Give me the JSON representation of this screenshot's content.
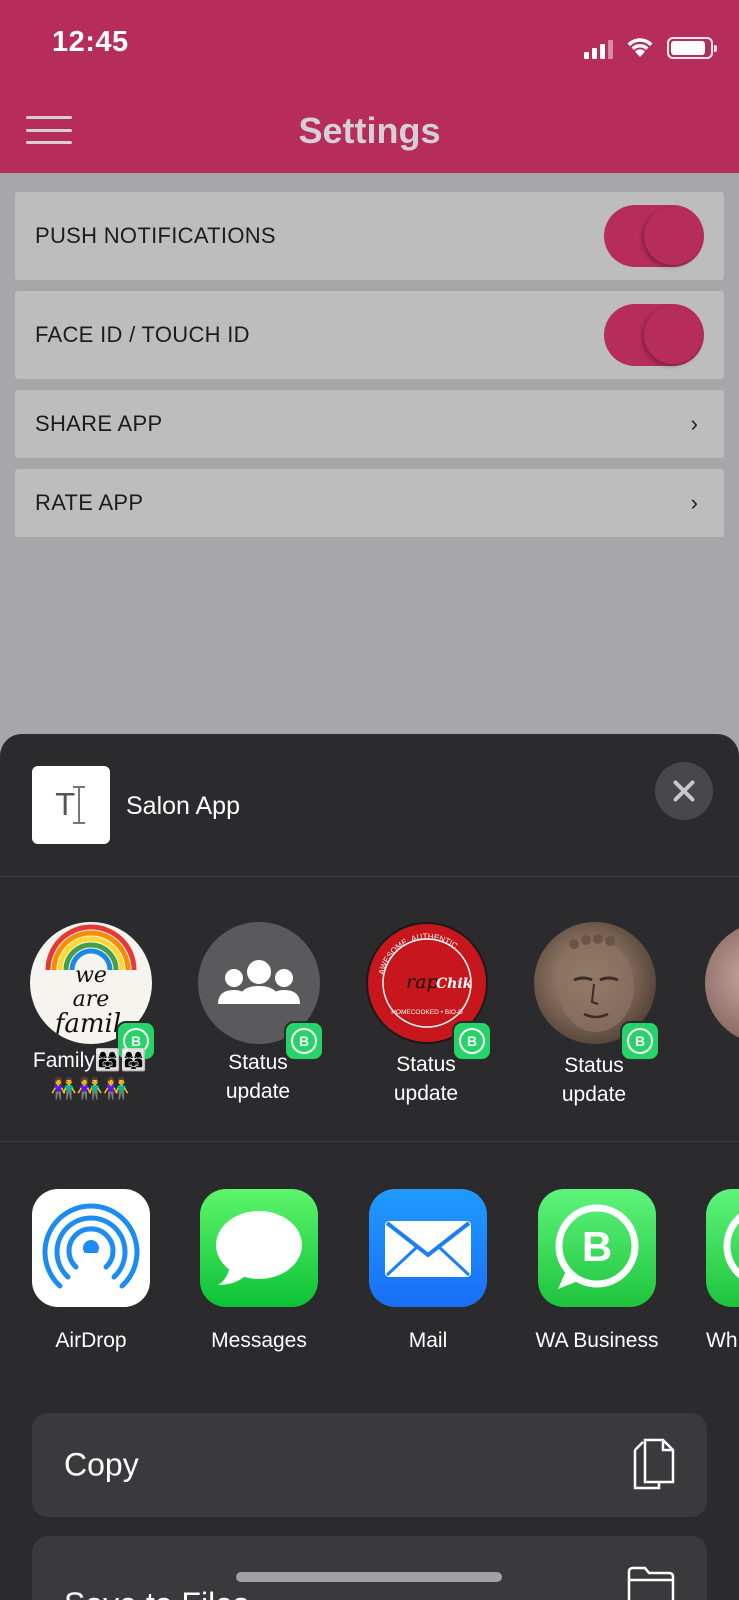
{
  "status_bar": {
    "time": "12:45",
    "battery_level": 0.9
  },
  "header": {
    "title": "Settings",
    "bg_color": "#b62d5c"
  },
  "settings": {
    "push_notifications": {
      "label": "PUSH NOTIFICATIONS",
      "enabled": true
    },
    "face_id": {
      "label": "FACE ID / TOUCH ID",
      "enabled": true
    },
    "share_app": {
      "label": "SHARE APP"
    },
    "rate_app": {
      "label": "RATE APP"
    }
  },
  "share_sheet": {
    "title": "Salon App",
    "thumb_text": "T",
    "contacts": [
      {
        "name": "Family👩‍👩‍👧👩‍👩‍👧\n👫👫👫",
        "avatar": "family-avatar"
      },
      {
        "name": "Status\nupdate",
        "avatar": "group-avatar"
      },
      {
        "name": "Status\nupdate",
        "avatar": "rapchik-logo-avatar"
      },
      {
        "name": "Status\nupdate",
        "avatar": "buddha-avatar"
      }
    ],
    "apps": [
      {
        "label": "AirDrop",
        "icon": "airdrop-icon"
      },
      {
        "label": "Messages",
        "icon": "messages-icon"
      },
      {
        "label": "Mail",
        "icon": "mail-icon"
      },
      {
        "label": "WA Business",
        "icon": "wa-business-icon"
      },
      {
        "label": "Wh",
        "icon": "whatsapp-icon"
      }
    ],
    "actions": {
      "copy": "Copy",
      "save_to_files": "Save to Files"
    },
    "logo_text": {
      "rapchik_ring": "AWESOME. AUTHENTIC. HOMECOOKED. BIO-DEGRADABLE",
      "rapchik_wordmark": "rap Chik",
      "family_art": "we are famil"
    }
  }
}
